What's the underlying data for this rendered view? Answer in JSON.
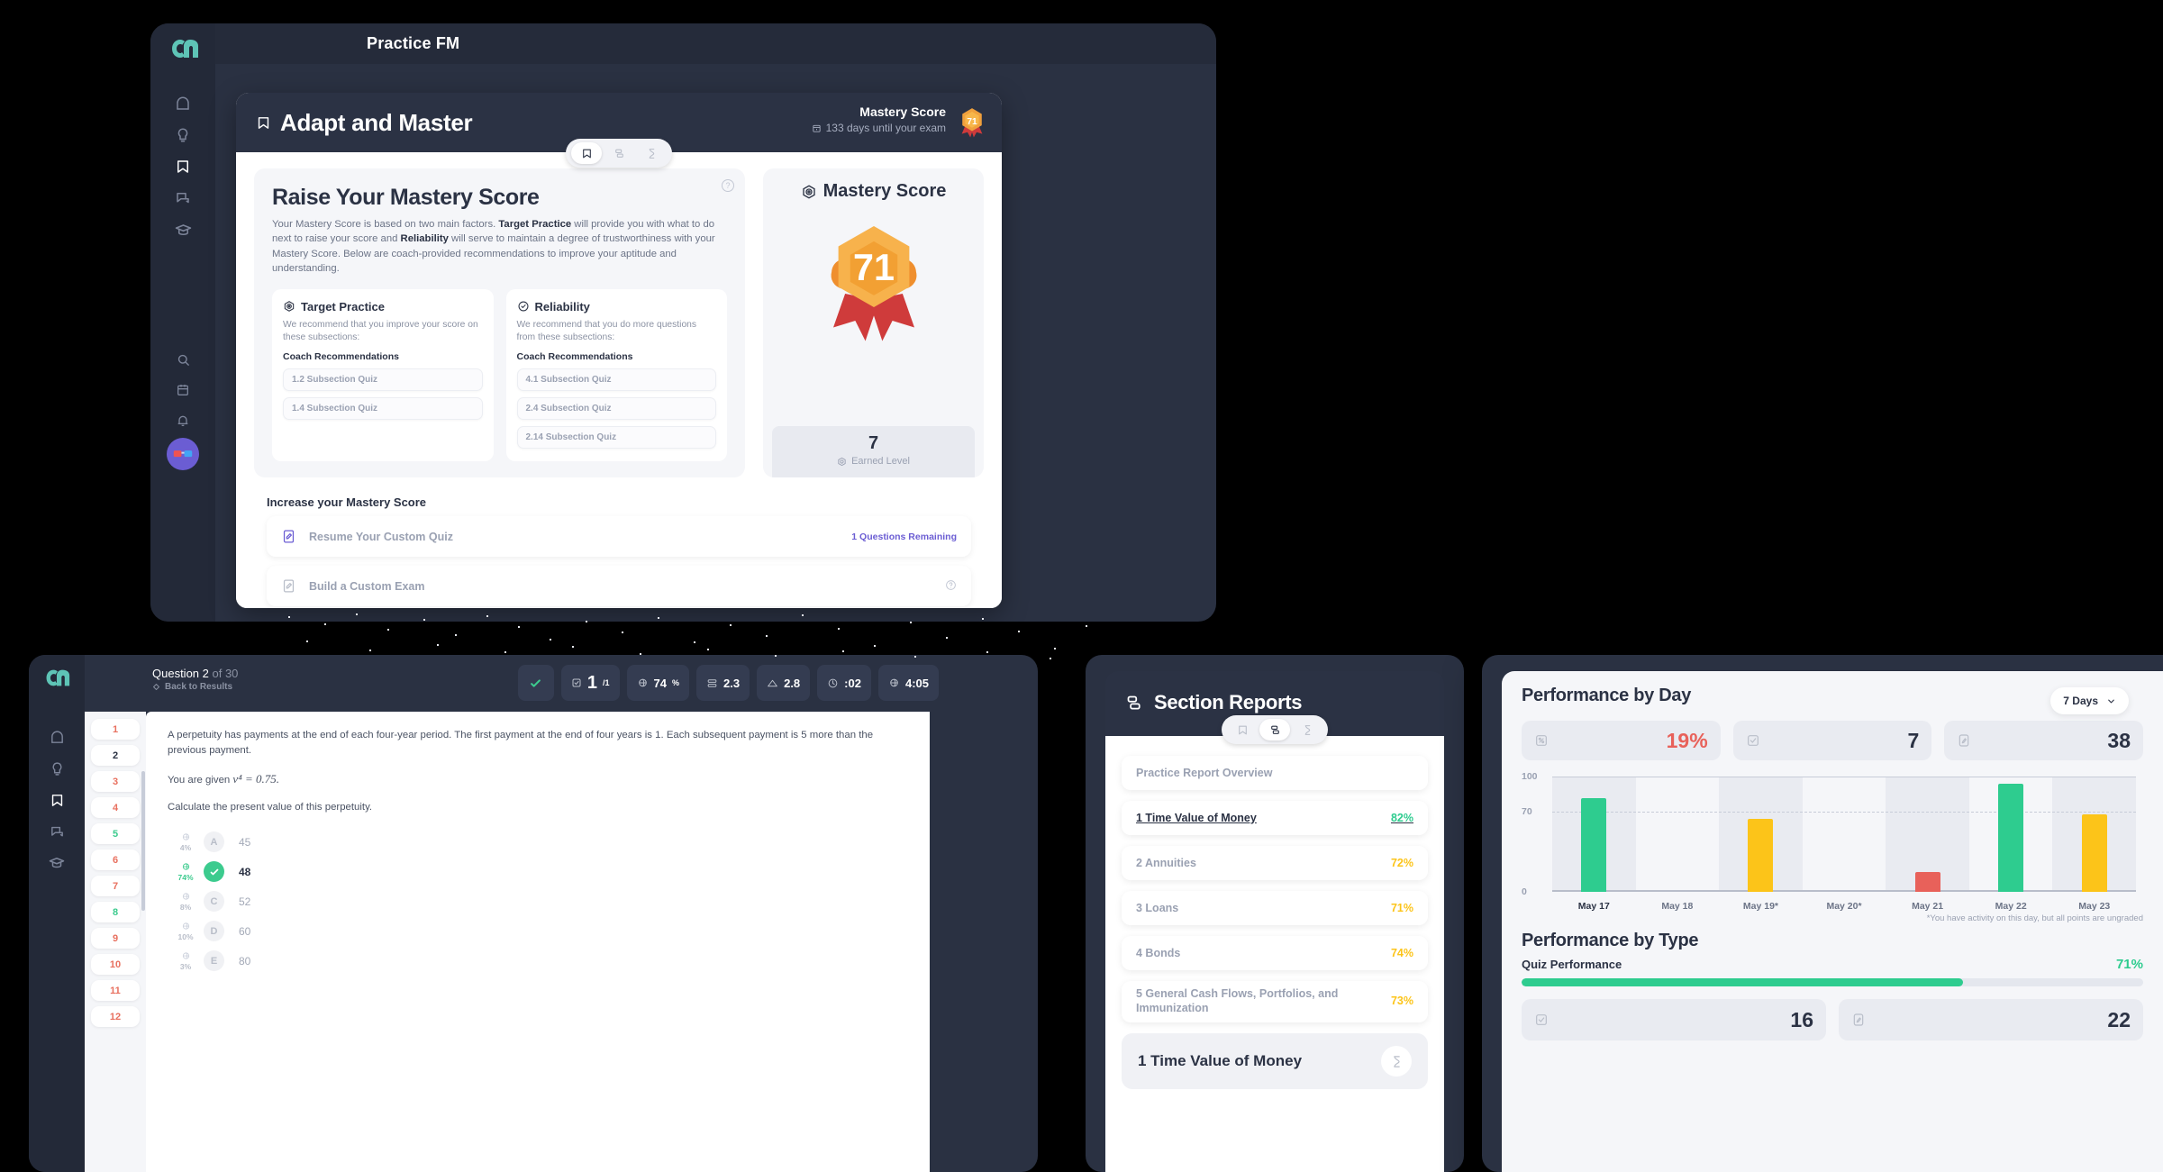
{
  "brand": {
    "accent_teal": "#5ec4b6",
    "purple": "#6b5dd3",
    "green": "#2ecc8f",
    "yellow": "#fcc419",
    "red": "#e8615a",
    "dark": "#2b3244"
  },
  "main_window": {
    "app_title": "Practice FM",
    "sidebar": [
      {
        "name": "home-icon",
        "icon": "home"
      },
      {
        "name": "lightbulb-icon",
        "icon": "bulb"
      },
      {
        "name": "bookmark-icon",
        "icon": "bookmark",
        "active": true
      },
      {
        "name": "chat-icon",
        "icon": "chat"
      },
      {
        "name": "graduation-icon",
        "icon": "cap"
      },
      {
        "name": "search-icon",
        "icon": "search"
      },
      {
        "name": "calendar-icon",
        "icon": "calendar"
      },
      {
        "name": "bell-icon",
        "icon": "bell"
      }
    ],
    "header": {
      "title": "Adapt and Master",
      "mastery_label": "Mastery Score",
      "days_text": "133 days until your exam",
      "badge_value": "71"
    },
    "tabs": [
      {
        "label": "bookmark",
        "active": true
      },
      {
        "label": "reports",
        "active": false
      },
      {
        "label": "timer",
        "active": false
      }
    ],
    "raise": {
      "heading": "Raise Your Mastery Score",
      "desc_1": "Your Mastery Score is based on two main factors. ",
      "desc_b1": "Target Practice",
      "desc_2": " will provide you with what to do next to raise your score and ",
      "desc_b2": "Reliability",
      "desc_3": " will serve to maintain a degree of trustworthiness with your Mastery Score. Below are coach-provided recommendations to improve your aptitude and understanding."
    },
    "target_practice": {
      "title": "Target Practice",
      "desc": "We recommend that you improve your score on these subsections:",
      "coach": "Coach Recommendations",
      "items": [
        "1.2 Subsection Quiz",
        "1.4 Subsection Quiz"
      ]
    },
    "reliability": {
      "title": "Reliability",
      "desc": "We recommend that you do more questions from these subsections:",
      "coach": "Coach Recommendations",
      "items": [
        "4.1 Subsection Quiz",
        "2.4 Subsection Quiz",
        "2.14 Subsection Quiz"
      ]
    },
    "mastery_panel": {
      "title": "Mastery Score",
      "score": "71",
      "level": "7",
      "level_label": "Earned Level"
    },
    "increase": {
      "heading": "Increase your Mastery Score",
      "rows": [
        {
          "label": "Resume Your Custom Quiz",
          "right": "1 Questions Remaining"
        },
        {
          "label": "Build a Custom Exam",
          "right": ""
        }
      ]
    }
  },
  "quiz_window": {
    "question_label": "Question 2",
    "question_of": " of 30",
    "back_label": "Back to Results",
    "stats": [
      {
        "name": "correct-check",
        "value": ""
      },
      {
        "name": "points",
        "value": "1",
        "suffix": "/1"
      },
      {
        "name": "percent-correct",
        "value": "74",
        "suffix": "%"
      },
      {
        "name": "difficulty",
        "value": "2.3"
      },
      {
        "name": "level",
        "value": "2.8"
      },
      {
        "name": "your-time",
        "value": ":02"
      },
      {
        "name": "avg-time",
        "value": "4:05"
      }
    ],
    "body": {
      "p1": "A perpetuity has payments at the end of each four-year period. The first payment at the end of four years is 1. Each subsequent payment is 5 more than the previous payment.",
      "p2_pre": "You are given ",
      "p2_math": "v⁴ = 0.75.",
      "p3": "Calculate the present value of this perpetuity."
    },
    "choices": [
      {
        "pct": "4%",
        "letter": "A",
        "value": "45",
        "correct": false
      },
      {
        "pct": "74%",
        "letter": "B",
        "value": "48",
        "correct": true
      },
      {
        "pct": "8%",
        "letter": "C",
        "value": "52",
        "correct": false
      },
      {
        "pct": "10%",
        "letter": "D",
        "value": "60",
        "correct": false
      },
      {
        "pct": "3%",
        "letter": "E",
        "value": "80",
        "correct": false
      }
    ],
    "question_list": [
      {
        "n": "1",
        "state": "wrong"
      },
      {
        "n": "2",
        "state": "current"
      },
      {
        "n": "3",
        "state": "wrong"
      },
      {
        "n": "4",
        "state": "wrong"
      },
      {
        "n": "5",
        "state": "correct"
      },
      {
        "n": "6",
        "state": "wrong"
      },
      {
        "n": "7",
        "state": "wrong"
      },
      {
        "n": "8",
        "state": "correct"
      },
      {
        "n": "9",
        "state": "wrong"
      },
      {
        "n": "10",
        "state": "wrong"
      },
      {
        "n": "11",
        "state": "wrong"
      },
      {
        "n": "12",
        "state": "wrong"
      }
    ]
  },
  "reports_window": {
    "title": "Section Reports",
    "tabs": [
      {
        "label": "bookmark",
        "active": false
      },
      {
        "label": "reports",
        "active": true
      },
      {
        "label": "timer",
        "active": false
      }
    ],
    "rows": [
      {
        "name": "Practice Report Overview",
        "pct": "",
        "selected": false
      },
      {
        "name": "1 Time Value of Money",
        "pct": "82%",
        "color": "#2ecc8f",
        "selected": true
      },
      {
        "name": "2 Annuities",
        "pct": "72%",
        "color": "#fcc419",
        "selected": false
      },
      {
        "name": "3 Loans",
        "pct": "71%",
        "color": "#fcc419",
        "selected": false
      },
      {
        "name": "4 Bonds",
        "pct": "74%",
        "color": "#fcc419",
        "selected": false
      },
      {
        "name": "5 General Cash Flows, Portfolios, and Immunization",
        "pct": "73%",
        "color": "#fcc419",
        "selected": false
      }
    ],
    "footer": {
      "label": "1 Time Value of Money",
      "icon": "hourglass-icon"
    }
  },
  "perf_window": {
    "title": "Performance by Day",
    "range_selector": "7 Days",
    "stats": [
      {
        "icon": "percent-icon",
        "value": "19%",
        "color": "#e8615a"
      },
      {
        "icon": "check-square-icon",
        "value": "7",
        "color": "#2b3244"
      },
      {
        "icon": "pencil-square-icon",
        "value": "38",
        "color": "#2b3244"
      }
    ],
    "footnote": "*You have activity on this day, but all points are ungraded",
    "title2": "Performance by Type",
    "quiz_perf_label": "Quiz Performance",
    "quiz_perf_value": "71%",
    "quiz_perf_pct": 71,
    "bottom_stats": [
      {
        "icon": "check-square-icon",
        "value": "16"
      },
      {
        "icon": "pencil-square-icon",
        "value": "22"
      }
    ]
  },
  "chart_data": {
    "type": "bar",
    "title": "Performance by Day",
    "categories": [
      "May 17",
      "May 18",
      "May 19*",
      "May 20*",
      "May 21",
      "May 22",
      "May 23"
    ],
    "values": [
      81,
      null,
      63,
      null,
      17,
      94,
      67
    ],
    "colors": [
      "#2ecc8f",
      null,
      "#fcc419",
      null,
      "#e8615a",
      "#2ecc8f",
      "#fcc419"
    ],
    "ylim": [
      0,
      100
    ],
    "yticks": [
      0,
      70,
      100
    ],
    "ylabel": "",
    "xlabel": "",
    "grid": true,
    "target_line": 70,
    "legend": "none",
    "note": "*You have activity on this day, but all points are ungraded"
  }
}
